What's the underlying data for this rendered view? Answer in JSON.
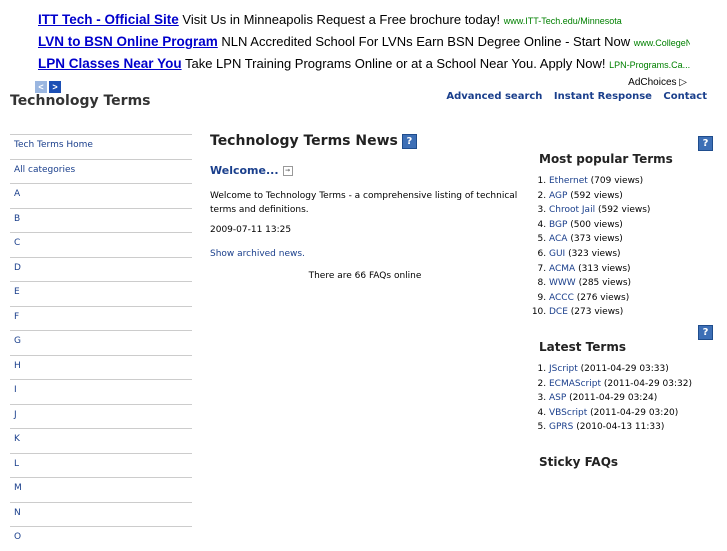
{
  "ad": {
    "rows": [
      {
        "title": "ITT Tech - Official Site",
        "desc": "Visit Us in Minneapolis Request a Free brochure today!",
        "url": "www.ITT-Tech.edu/Minnesota"
      },
      {
        "title": "LVN to BSN Online Program",
        "desc": "NLN Accredited School For LVNs Earn BSN Degree Online - Start Now",
        "url": "www.CollegeN..."
      },
      {
        "title": "LPN Classes Near You",
        "desc": "Take LPN Training Programs Online or at a School Near You. Apply Now!",
        "url": "LPN-Programs.Ca..."
      }
    ],
    "prev": "<",
    "next": ">",
    "adchoices": "AdChoices ▷"
  },
  "header": {
    "title": "Technology Terms",
    "links": [
      "Advanced search",
      "Instant Response",
      "Contact"
    ]
  },
  "leftnav": [
    "Tech Terms Home",
    "All categories",
    "A",
    "B",
    "C",
    "D",
    "E",
    "F",
    "G",
    "H",
    "I",
    "J",
    "K",
    "L",
    "M",
    "N",
    "O"
  ],
  "center": {
    "title": "Technology Terms News",
    "help": "?",
    "welcome_title": "Welcome...",
    "body": "Welcome to Technology Terms - a comprehensive listing of technical terms and definitions.",
    "date": "2009-07-11 13:25",
    "archived": "Show archived news.",
    "faqs_online": "There are 66 FAQs online"
  },
  "right": {
    "popular_title": "Most popular Terms",
    "popular": [
      {
        "term": "Ethernet",
        "count": "(709 views)"
      },
      {
        "term": "AGP",
        "count": "(592 views)"
      },
      {
        "term": "Chroot Jail",
        "count": "(592 views)"
      },
      {
        "term": "BGP",
        "count": "(500 views)"
      },
      {
        "term": "ACA",
        "count": "(373 views)"
      },
      {
        "term": "GUI",
        "count": "(323 views)"
      },
      {
        "term": "ACMA",
        "count": "(313 views)"
      },
      {
        "term": "WWW",
        "count": "(285 views)"
      },
      {
        "term": "ACCC",
        "count": "(276 views)"
      },
      {
        "term": "DCE",
        "count": "(273 views)"
      }
    ],
    "latest_title": "Latest Terms",
    "latest": [
      {
        "term": "JScript",
        "date": "(2011-04-29 03:33)"
      },
      {
        "term": "ECMAScript",
        "date": "(2011-04-29 03:32)"
      },
      {
        "term": "ASP",
        "date": "(2011-04-29 03:24)"
      },
      {
        "term": "VBScript",
        "date": "(2011-04-29 03:20)"
      },
      {
        "term": "GPRS",
        "date": "(2010-04-13 11:33)"
      }
    ],
    "sticky_title": "Sticky FAQs"
  }
}
